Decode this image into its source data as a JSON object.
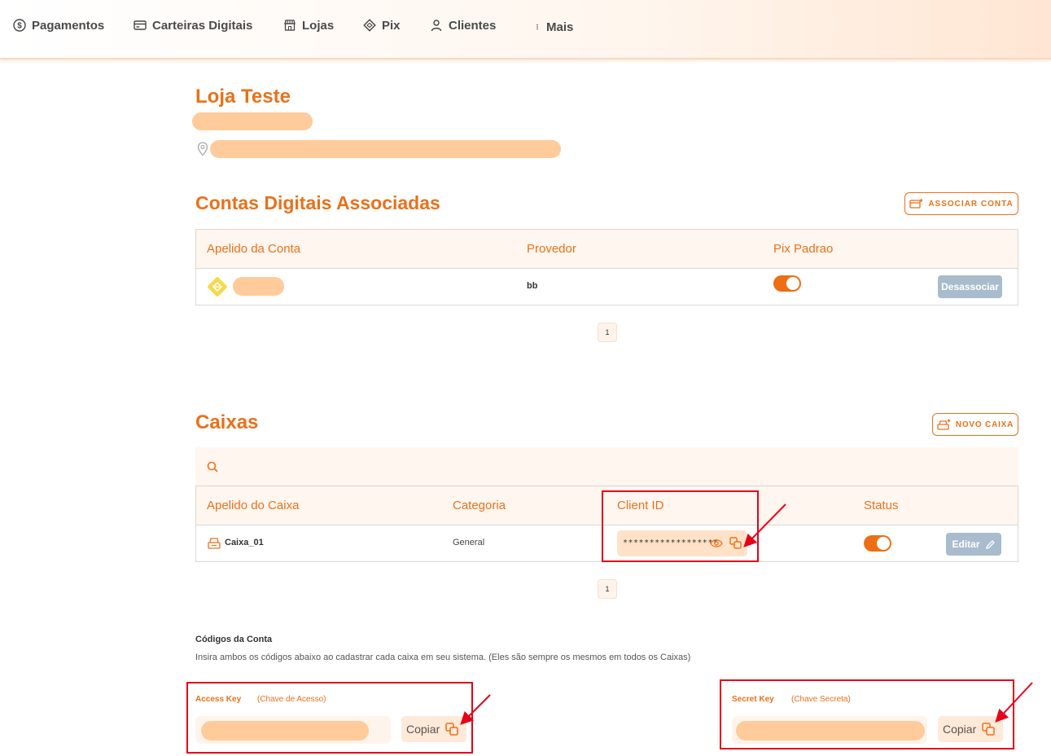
{
  "nav": {
    "items": [
      {
        "label": "Pagamentos",
        "icon": "dollar-circle-icon"
      },
      {
        "label": "Carteiras Digitais",
        "icon": "credit-card-icon"
      },
      {
        "label": "Lojas",
        "icon": "store-icon"
      },
      {
        "label": "Pix",
        "icon": "pix-icon"
      },
      {
        "label": "Clientes",
        "icon": "user-icon"
      },
      {
        "label": "Mais",
        "icon": "vertical-dots-icon"
      }
    ]
  },
  "store": {
    "title": "Loja Teste",
    "location_icon": "map-pin-icon"
  },
  "accounts": {
    "title": "Contas Digitais Associadas",
    "associate_button": "ASSOCIAR CONTA",
    "columns": [
      "Apelido da Conta",
      "Provedor",
      "Pix Padrao"
    ],
    "rows": [
      {
        "provider": "bb",
        "pix_default": true,
        "action": "Desassociar"
      }
    ],
    "page": "1"
  },
  "registers": {
    "title": "Caixas",
    "new_button": "NOVO CAIXA",
    "search_placeholder": "",
    "columns": [
      "Apelido do Caixa",
      "Categoria",
      "Client ID",
      "Status"
    ],
    "rows": [
      {
        "name": "Caixa_01",
        "category": "General",
        "client_id": "******************",
        "status": true,
        "action": "Editar"
      }
    ],
    "page": "1"
  },
  "codes": {
    "title": "Códigos da Conta",
    "description": "Insira ambos os códigos abaixo ao cadastrar cada caixa em seu sistema. (Eles são sempre os mesmos em todos os Caixas)",
    "access_key_label": "Access Key",
    "access_key_sub": "(Chave de Acesso)",
    "secret_key_label": "Secret Key",
    "secret_key_sub": "(Chave Secreta)",
    "copy_label": "Copiar"
  },
  "colors": {
    "accent": "#e9711a",
    "annotation": "#e6001a",
    "redacted": "#ffcb9a"
  }
}
